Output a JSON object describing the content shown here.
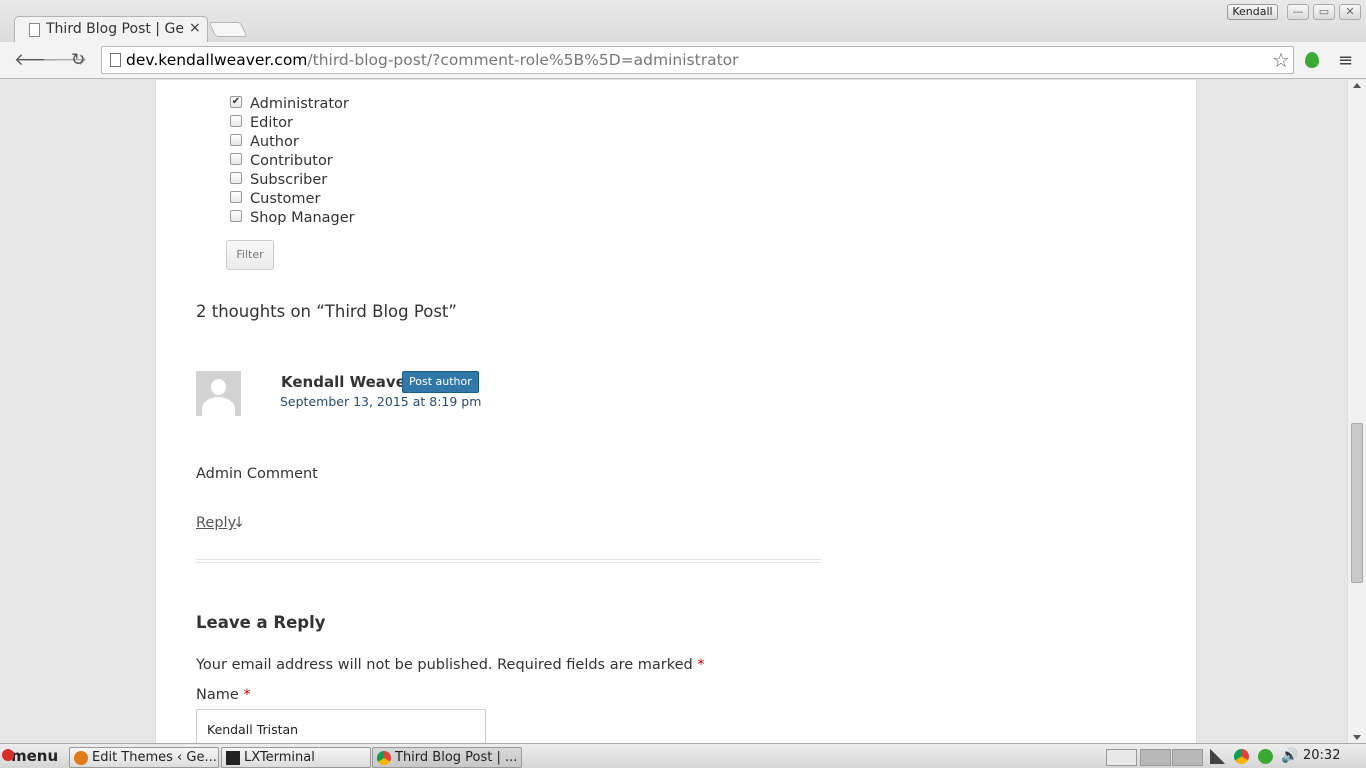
{
  "browser": {
    "tab_title": "Third Blog Post | Ge",
    "tab_close": "×",
    "profile_name": "Kendall",
    "url_host": "dev.kendallweaver.com",
    "url_path": "/third-blog-post/?comment-role%5B%5D=administrator",
    "window_buttons": {
      "minimize": "—",
      "maximize": "▭",
      "close": "✕"
    },
    "nav": {
      "back": "🡐",
      "forward": "🡒",
      "reload": "↻",
      "star": "☆",
      "menu": "≡"
    }
  },
  "filter": {
    "roles": [
      {
        "label": "Administrator",
        "checked": true
      },
      {
        "label": "Editor",
        "checked": false
      },
      {
        "label": "Author",
        "checked": false
      },
      {
        "label": "Contributor",
        "checked": false
      },
      {
        "label": "Subscriber",
        "checked": false
      },
      {
        "label": "Customer",
        "checked": false
      },
      {
        "label": "Shop Manager",
        "checked": false
      }
    ],
    "button_label": "Filter"
  },
  "comments": {
    "heading": "2 thoughts on “Third Blog Post”",
    "items": [
      {
        "author": "Kendall Weaver",
        "badge": "Post author",
        "date": "September 13, 2015 at 8:19 pm",
        "body": "Admin Comment",
        "reply_label": "Reply",
        "reply_arrow": "↓"
      }
    ]
  },
  "reply_form": {
    "title": "Leave a Reply",
    "notes": "Your email address will not be published. Required fields are marked",
    "required_mark": "*",
    "name_label": "Name",
    "name_value": "Kendall Tristan"
  },
  "taskbar": {
    "start_label": "menu",
    "tasks": [
      {
        "label": "Edit Themes ‹ Ge..."
      },
      {
        "label": "LXTerminal"
      },
      {
        "label": "Third Blog Post | ..."
      }
    ],
    "clock": "20:32"
  },
  "colors": {
    "badge": "#2f78a8",
    "required": "#cc0000",
    "link": "#2b4b6d"
  }
}
